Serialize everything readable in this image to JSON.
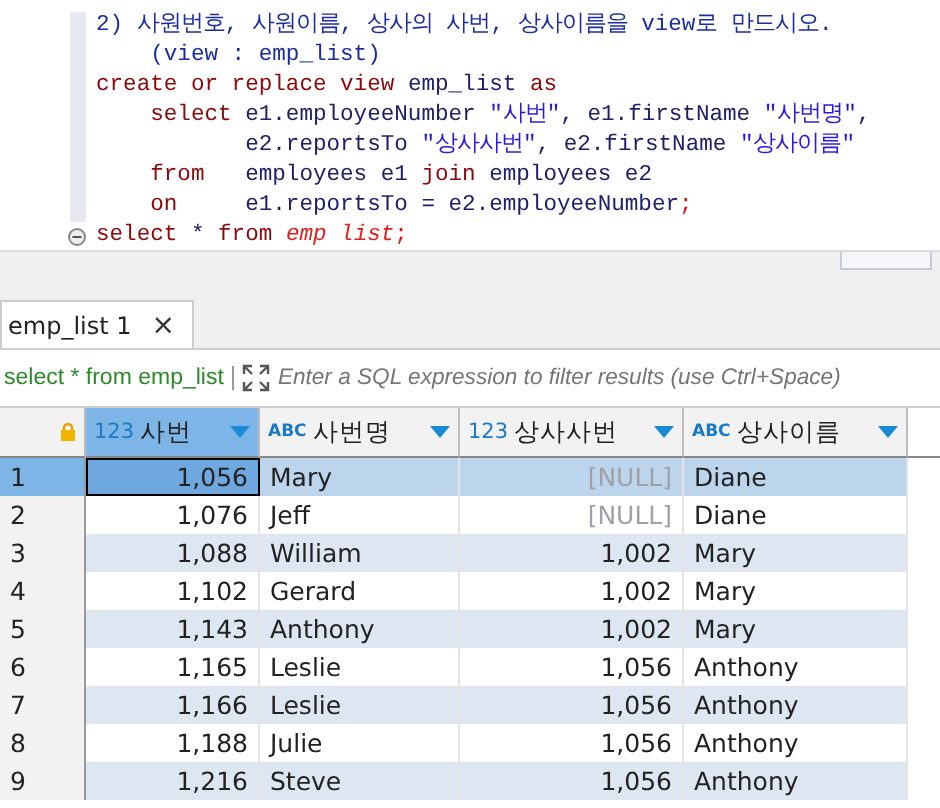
{
  "editor": {
    "lines": [
      {
        "folded": false,
        "tokens": [
          {
            "kind": "comment",
            "text": "2) 사원번호, 사원이름, 상사의 사번, 상사이름을 view로 만드시오."
          }
        ]
      },
      {
        "folded": false,
        "tokens": [
          {
            "kind": "comment",
            "text": "    (view : emp_list)"
          }
        ]
      },
      {
        "folded": false,
        "tokens": [
          {
            "kind": "keyword",
            "text": "create or replace view "
          },
          {
            "kind": "plain",
            "text": "emp_list "
          },
          {
            "kind": "keyword",
            "text": "as"
          }
        ]
      },
      {
        "folded": false,
        "tokens": [
          {
            "kind": "keyword",
            "text": "    select "
          },
          {
            "kind": "plain",
            "text": "e1.employeeNumber "
          },
          {
            "kind": "string",
            "text": "\"사번\""
          },
          {
            "kind": "plain",
            "text": ", e1.firstName "
          },
          {
            "kind": "string",
            "text": "\"사번명\""
          },
          {
            "kind": "plain",
            "text": ","
          }
        ]
      },
      {
        "folded": false,
        "tokens": [
          {
            "kind": "plain",
            "text": "           e2.reportsTo "
          },
          {
            "kind": "string",
            "text": "\"상사사번\""
          },
          {
            "kind": "plain",
            "text": ", e2.firstName "
          },
          {
            "kind": "string",
            "text": "\"상사이름\""
          }
        ]
      },
      {
        "folded": false,
        "tokens": [
          {
            "kind": "keyword",
            "text": "    from   "
          },
          {
            "kind": "plain",
            "text": "employees e1 "
          },
          {
            "kind": "keyword",
            "text": "join "
          },
          {
            "kind": "plain",
            "text": "employees e2"
          }
        ]
      },
      {
        "folded": false,
        "tokens": [
          {
            "kind": "keyword",
            "text": "    on     "
          },
          {
            "kind": "plain",
            "text": "e1.reportsTo = e2.employeeNumber"
          },
          {
            "kind": "punct",
            "text": ";"
          }
        ]
      },
      {
        "folded": true,
        "tokens": [
          {
            "kind": "keyword",
            "text": "select "
          },
          {
            "kind": "plain",
            "text": "* "
          },
          {
            "kind": "keyword",
            "text": "from "
          },
          {
            "kind": "italic",
            "text": "emp list"
          },
          {
            "kind": "punct",
            "text": ";"
          }
        ]
      }
    ]
  },
  "tabs": [
    {
      "label": "emp_list 1",
      "close": "×",
      "selected": true
    }
  ],
  "filter": {
    "query": "select * from emp_list",
    "placeholder": "Enter a SQL expression to filter results (use Ctrl+Space)"
  },
  "table": {
    "columns": [
      {
        "type_label": "123",
        "kind": "number",
        "name": "사번",
        "selected": true
      },
      {
        "type_label": "ABC",
        "kind": "text",
        "name": "사번명",
        "selected": false
      },
      {
        "type_label": "123",
        "kind": "number",
        "name": "상사사번",
        "selected": false
      },
      {
        "type_label": "ABC",
        "kind": "text",
        "name": "상사이름",
        "selected": false
      }
    ],
    "rows": [
      {
        "num": "1",
        "selected": true,
        "cells": [
          "1,056",
          "Mary",
          "[NULL]",
          "Diane"
        ]
      },
      {
        "num": "2",
        "selected": false,
        "cells": [
          "1,076",
          "Jeff",
          "[NULL]",
          "Diane"
        ]
      },
      {
        "num": "3",
        "selected": false,
        "cells": [
          "1,088",
          "William",
          "1,002",
          "Mary"
        ]
      },
      {
        "num": "4",
        "selected": false,
        "cells": [
          "1,102",
          "Gerard",
          "1,002",
          "Mary"
        ]
      },
      {
        "num": "5",
        "selected": false,
        "cells": [
          "1,143",
          "Anthony",
          "1,002",
          "Mary"
        ]
      },
      {
        "num": "6",
        "selected": false,
        "cells": [
          "1,165",
          "Leslie",
          "1,056",
          "Anthony"
        ]
      },
      {
        "num": "7",
        "selected": false,
        "cells": [
          "1,166",
          "Leslie",
          "1,056",
          "Anthony"
        ]
      },
      {
        "num": "8",
        "selected": false,
        "cells": [
          "1,188",
          "Julie",
          "1,056",
          "Anthony"
        ]
      },
      {
        "num": "9",
        "selected": false,
        "cells": [
          "1,216",
          "Steve",
          "1,056",
          "Anthony"
        ]
      }
    ]
  }
}
